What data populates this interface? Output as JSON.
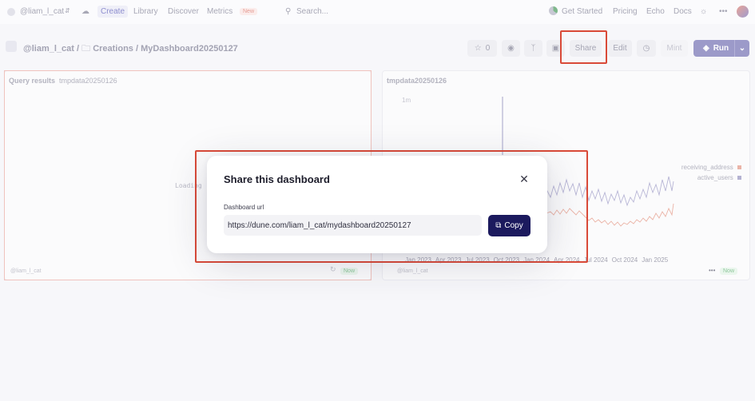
{
  "nav": {
    "user": "@liam_l_cat",
    "items": [
      "Create",
      "Library",
      "Discover",
      "Metrics"
    ],
    "new_badge": "New",
    "search_placeholder": "Search...",
    "right_items": [
      "Get Started",
      "Pricing",
      "Echo",
      "Docs"
    ],
    "more": "•••"
  },
  "header": {
    "breadcrumb_user": "@liam_l_cat",
    "breadcrumb_sep": "/",
    "breadcrumb_folder": "Creations",
    "breadcrumb_name": "MyDashboard20250127",
    "star_count": "0",
    "share_label": "Share",
    "edit_label": "Edit",
    "mint_label": "Mint",
    "run_label": "Run"
  },
  "panel_left": {
    "title": "Query results",
    "subtitle": "tmpdata20250126",
    "loading": "Loading",
    "footer_user": "@liam_l_cat",
    "now": "Now"
  },
  "panel_right": {
    "title": "tmpdata20250126",
    "y_tick": "1m",
    "legend": [
      {
        "name": "receiving_address",
        "color": "#eab4a8"
      },
      {
        "name": "active_users",
        "color": "#b4b2d2"
      }
    ],
    "x_ticks": [
      "Jan 2023",
      "Apr 2023",
      "Jul 2023",
      "Oct 2023",
      "Jan 2024",
      "Apr 2024",
      "Jul 2024",
      "Oct 2024",
      "Jan 2025"
    ],
    "footer_user": "@liam_l_cat",
    "footer_more": "•••",
    "now": "Now"
  },
  "modal": {
    "title": "Share this dashboard",
    "field_label": "Dashboard url",
    "url": "https://dune.com/liam_l_cat/mydashboard20250127",
    "copy_label": "Copy"
  },
  "colors": {
    "accent": "#1c1a5e",
    "highlight": "#d94a38",
    "run": "#9c9ac9"
  }
}
